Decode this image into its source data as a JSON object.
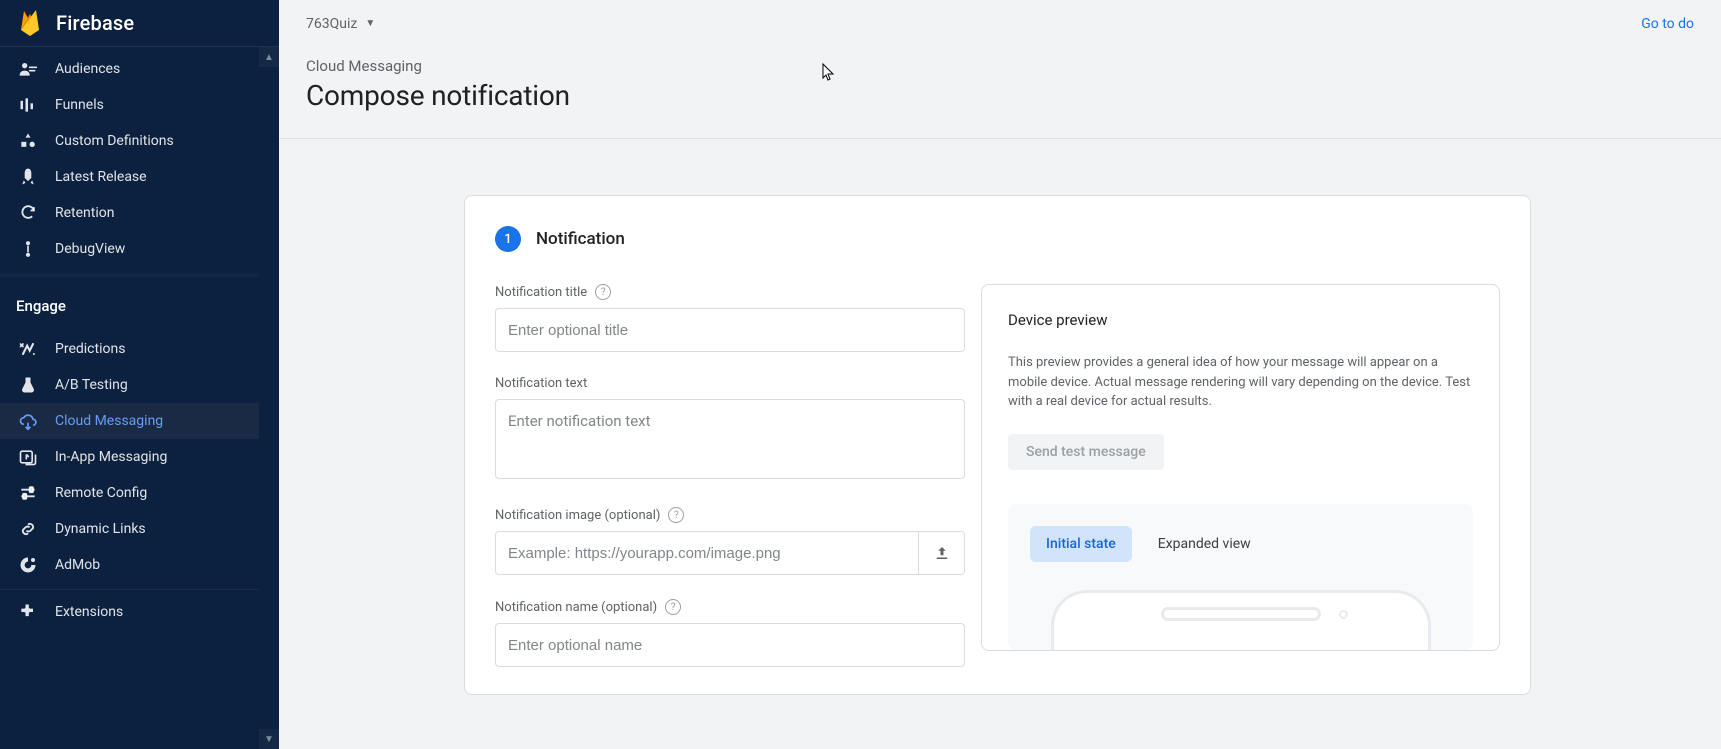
{
  "brand": "Firebase",
  "project": {
    "name": "763Quiz"
  },
  "topbar": {
    "goto": "Go to do"
  },
  "sidebar": {
    "items_top": [
      {
        "id": "audiences",
        "label": "Audiences"
      },
      {
        "id": "funnels",
        "label": "Funnels"
      },
      {
        "id": "custom-definitions",
        "label": "Custom Definitions"
      },
      {
        "id": "latest-release",
        "label": "Latest Release"
      },
      {
        "id": "retention",
        "label": "Retention"
      },
      {
        "id": "debugview",
        "label": "DebugView"
      }
    ],
    "section_engage": "Engage",
    "items_engage": [
      {
        "id": "predictions",
        "label": "Predictions"
      },
      {
        "id": "ab-testing",
        "label": "A/B Testing"
      },
      {
        "id": "cloud-messaging",
        "label": "Cloud Messaging",
        "active": true
      },
      {
        "id": "in-app-messaging",
        "label": "In-App Messaging"
      },
      {
        "id": "remote-config",
        "label": "Remote Config"
      },
      {
        "id": "dynamic-links",
        "label": "Dynamic Links"
      },
      {
        "id": "admob",
        "label": "AdMob"
      }
    ],
    "items_bottom": [
      {
        "id": "extensions",
        "label": "Extensions"
      }
    ]
  },
  "page": {
    "breadcrumb": "Cloud Messaging",
    "title": "Compose notification"
  },
  "step": {
    "number": "1",
    "title": "Notification"
  },
  "form": {
    "title_label": "Notification title",
    "title_placeholder": "Enter optional title",
    "text_label": "Notification text",
    "text_placeholder": "Enter notification text",
    "image_label": "Notification image (optional)",
    "image_placeholder": "Example: https://yourapp.com/image.png",
    "name_label": "Notification name (optional)",
    "name_placeholder": "Enter optional name"
  },
  "preview": {
    "title": "Device preview",
    "description": "This preview provides a general idea of how your message will appear on a mobile device. Actual message rendering will vary depending on the device. Test with a real device for actual results.",
    "send_test": "Send test message",
    "tab_initial": "Initial state",
    "tab_expanded": "Expanded view"
  }
}
